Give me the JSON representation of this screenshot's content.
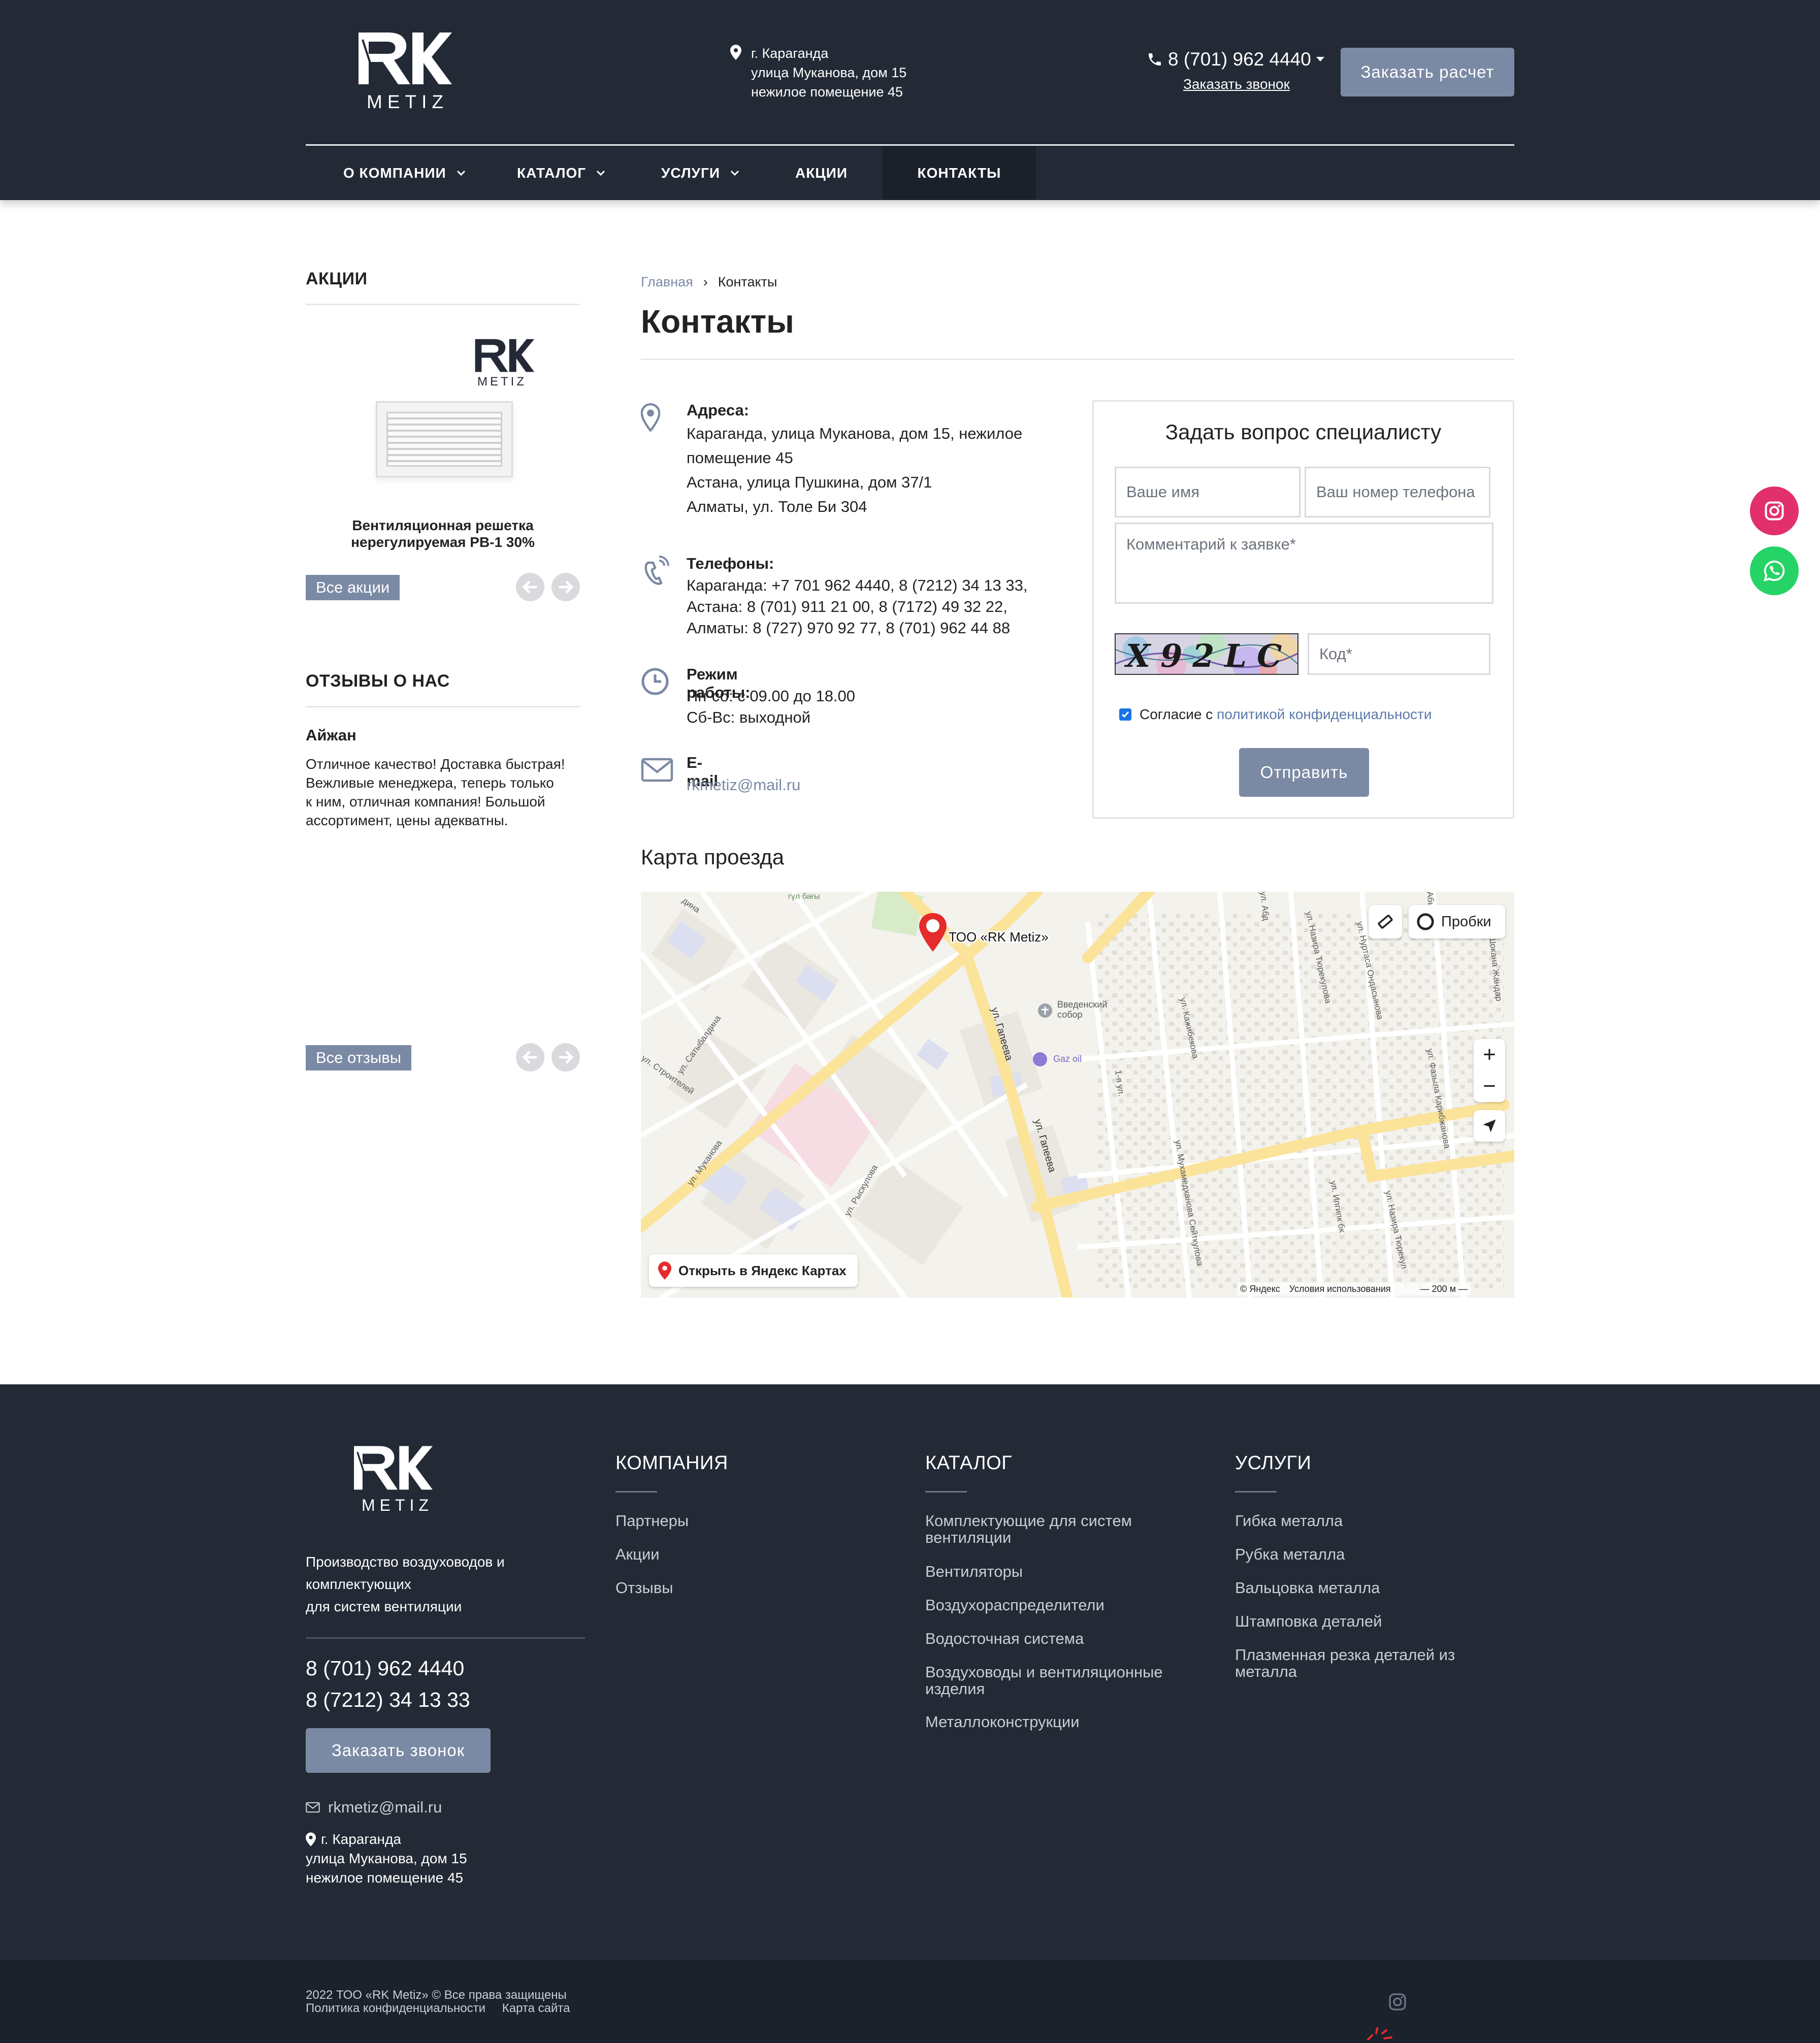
{
  "header": {
    "logo_text": "METIZ",
    "address": [
      "г. Караганда",
      "улица Муканова, дом 15",
      "нежилое помещение 45"
    ],
    "phone": "8 (701) 962 4440",
    "call_link": "Заказать звонок",
    "calc_button": "Заказать расчет",
    "nav": [
      {
        "label": "О КОМПАНИИ",
        "dropdown": true
      },
      {
        "label": "КАТАЛОГ",
        "dropdown": true
      },
      {
        "label": "УСЛУГИ",
        "dropdown": true
      },
      {
        "label": "АКЦИИ",
        "dropdown": false
      },
      {
        "label": "КОНТАКТЫ",
        "dropdown": false,
        "active": true
      }
    ]
  },
  "sidebar": {
    "promo_heading": "АКЦИИ",
    "promo_logo": "METIZ",
    "promo_title": [
      "Вентиляционная решетка",
      "нерегулируемая РВ-1 30%"
    ],
    "promo_all": "Все акции",
    "reviews_heading": "ОТЗЫВЫ О НАС",
    "review_author": "Айжан",
    "review_text": [
      "Отличное качество! Доставка быстрая!",
      "Вежливые менеджера, теперь только",
      "к ним, отличная компания! Большой",
      "ассортимент, цены адекватны."
    ],
    "reviews_all": "Все отзывы"
  },
  "breadcrumbs": {
    "home": "Главная",
    "sep": "›",
    "current": "Контакты"
  },
  "page_title": "Контакты",
  "contacts": {
    "address_label": "Адреса:",
    "address_lines": [
      "Караганда, улица Муканова, дом 15, нежилое",
      "помещение 45",
      "Астана, улица Пушкина, дом 37/1",
      "Алматы, ул. Толе Би 304"
    ],
    "phones_label": "Телефоны:",
    "phones_lines": [
      "Караганда: +7 701 962 4440, 8 (7212) 34 13 33,",
      "Астана: 8 (701) 911 21 00, 8 (7172) 49 32 22,",
      "Алматы: 8 (727) 970 92 77, 8 (701) 962 44 88"
    ],
    "hours_label": "Режим работы:",
    "hours_lines": [
      "Пн-сб: с 09.00 до 18.00",
      "Сб-Вс: выходной"
    ],
    "email_label": "E-mail",
    "email": "rkmetiz@mail.ru"
  },
  "form": {
    "title": "Задать вопрос специалисту",
    "name_placeholder": "Ваше имя",
    "phone_placeholder": "Ваш номер телефона",
    "comment_placeholder": "Комментарий к заявке*",
    "captcha_text": "X92LC",
    "code_placeholder": "Код*",
    "agree_prefix": "Согласие с",
    "agree_link": "политикой конфиденциальности",
    "agree_checked": true,
    "submit": "Отправить"
  },
  "map": {
    "title": "Карта проезда",
    "marker_label": "ТОО «RK Metiz»",
    "traffic": "Пробки",
    "open_yandex": "Открыть в Яндекс Картах",
    "copyright": "© Яндекс",
    "terms": "Условия использования",
    "scale": "200 м",
    "labels": {
      "gul": "гүл бағы",
      "dina": "дина",
      "satybaldin": "ул. Сатыбалдина",
      "stroiteley": "ул. Строителей",
      "mukanova": "ул. Муканова",
      "ryskulova": "ул. Рыскулова",
      "gapeeva1": "ул. Гапеева",
      "gapeeva2": "ул. Гапеева",
      "sobor": [
        "Введенский",
        "собор"
      ],
      "gazoil": "Gaz oil",
      "first": "1-я ул.",
      "kazhibekova": "ул. Кажибекова",
      "seitkulova": "ул. Мухамедханова Сейткулова",
      "nazira1": "ул. Назира Тюрекулова",
      "ondasynova": "ул. Нуртаса Ондасынова",
      "karibzhanova": "ул. Фазыла Карибжанова",
      "shokan": "ул. Шокана Жандар",
      "abysheva": "Абышева",
      "alibek": "ул. Ипгипк бк",
      "nazira2": "ул. Назира Тюрекул",
      "abd": "ул. Абд"
    }
  },
  "footer": {
    "logo_text": "METIZ",
    "description": [
      "Производство воздуховодов и",
      "комплектующих",
      "для систем вентиляции"
    ],
    "phones": [
      "8 (701) 962 4440",
      "8 (7212) 34 13 33"
    ],
    "call_button": "Заказать звонок",
    "email": "rkmetiz@mail.ru",
    "address": [
      "г. Караганда",
      "улица Муканова, дом 15",
      "нежилое помещение 45"
    ],
    "company": {
      "heading": "КОМПАНИЯ",
      "links": [
        "Партнеры",
        "Акции",
        "Отзывы"
      ]
    },
    "catalog": {
      "heading": "КАТАЛОГ",
      "links": [
        [
          "Комплектующие для систем",
          "вентиляции"
        ],
        [
          "Вентиляторы"
        ],
        [
          "Воздухораспределители"
        ],
        [
          "Водосточная система"
        ],
        [
          "Воздуховоды и вентиляционные",
          "изделия"
        ],
        [
          "Металлоконструкции"
        ]
      ]
    },
    "services": {
      "heading": "УСЛУГИ",
      "links": [
        [
          "Гибка металла"
        ],
        [
          "Рубка металла"
        ],
        [
          "Вальцовка металла"
        ],
        [
          "Штамповка деталей"
        ],
        [
          "Плазменная резка деталей из",
          "металла"
        ]
      ]
    },
    "copyright": "2022 ТОО «RK Metiz» © Все права защищены",
    "privacy": "Политика конфиденциальности",
    "sitemap": "Карта сайта"
  },
  "colors": {
    "header_bg": "#232a36",
    "accent": "#7b8aa4",
    "link": "#5a7aa8",
    "instagram": "#e1306c",
    "whatsapp": "#25d366"
  },
  "icons": [
    "location-pin-icon",
    "phone-icon",
    "clock-icon",
    "mail-icon",
    "instagram-icon",
    "whatsapp-icon",
    "chevron-down-icon",
    "arrow-left-icon",
    "arrow-right-icon"
  ]
}
